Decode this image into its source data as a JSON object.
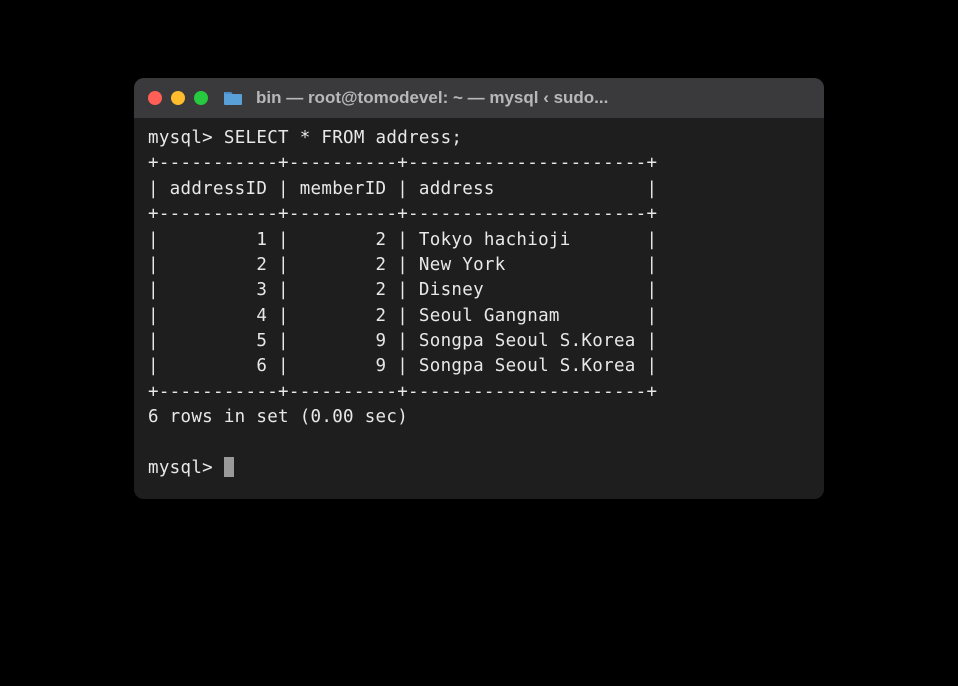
{
  "window": {
    "title": "bin — root@tomodevel: ~ — mysql ‹ sudo..."
  },
  "terminal": {
    "prompt": "mysql>",
    "query": "SELECT * FROM address;",
    "border": "+-----------+----------+----------------------+",
    "header_row": "| addressID | memberID | address              |",
    "rows": [
      "|         1 |        2 | Tokyo hachioji       |",
      "|         2 |        2 | New York             |",
      "|         3 |        2 | Disney               |",
      "|         4 |        2 | Seoul Gangnam        |",
      "|         5 |        9 | Songpa Seoul S.Korea |",
      "|         6 |        9 | Songpa Seoul S.Korea |"
    ],
    "footer": "6 rows in set (0.00 sec)",
    "table_data": {
      "columns": [
        "addressID",
        "memberID",
        "address"
      ],
      "data": [
        {
          "addressID": 1,
          "memberID": 2,
          "address": "Tokyo hachioji"
        },
        {
          "addressID": 2,
          "memberID": 2,
          "address": "New York"
        },
        {
          "addressID": 3,
          "memberID": 2,
          "address": "Disney"
        },
        {
          "addressID": 4,
          "memberID": 2,
          "address": "Seoul Gangnam"
        },
        {
          "addressID": 5,
          "memberID": 9,
          "address": "Songpa Seoul S.Korea"
        },
        {
          "addressID": 6,
          "memberID": 9,
          "address": "Songpa Seoul S.Korea"
        }
      ]
    }
  }
}
